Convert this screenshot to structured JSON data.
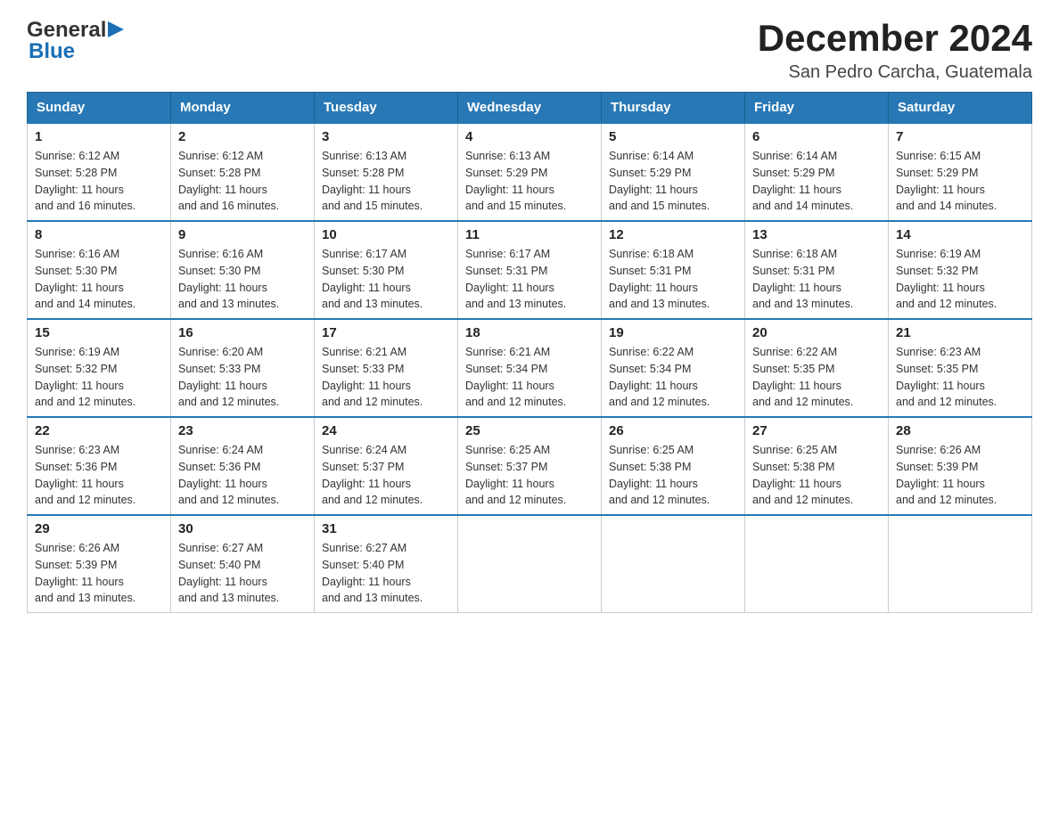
{
  "header": {
    "logo_general": "General",
    "logo_blue": "Blue",
    "title": "December 2024",
    "subtitle": "San Pedro Carcha, Guatemala"
  },
  "weekdays": [
    "Sunday",
    "Monday",
    "Tuesday",
    "Wednesday",
    "Thursday",
    "Friday",
    "Saturday"
  ],
  "weeks": [
    [
      {
        "day": "1",
        "sunrise": "6:12 AM",
        "sunset": "5:28 PM",
        "daylight": "11 hours and 16 minutes."
      },
      {
        "day": "2",
        "sunrise": "6:12 AM",
        "sunset": "5:28 PM",
        "daylight": "11 hours and 16 minutes."
      },
      {
        "day": "3",
        "sunrise": "6:13 AM",
        "sunset": "5:28 PM",
        "daylight": "11 hours and 15 minutes."
      },
      {
        "day": "4",
        "sunrise": "6:13 AM",
        "sunset": "5:29 PM",
        "daylight": "11 hours and 15 minutes."
      },
      {
        "day": "5",
        "sunrise": "6:14 AM",
        "sunset": "5:29 PM",
        "daylight": "11 hours and 15 minutes."
      },
      {
        "day": "6",
        "sunrise": "6:14 AM",
        "sunset": "5:29 PM",
        "daylight": "11 hours and 14 minutes."
      },
      {
        "day": "7",
        "sunrise": "6:15 AM",
        "sunset": "5:29 PM",
        "daylight": "11 hours and 14 minutes."
      }
    ],
    [
      {
        "day": "8",
        "sunrise": "6:16 AM",
        "sunset": "5:30 PM",
        "daylight": "11 hours and 14 minutes."
      },
      {
        "day": "9",
        "sunrise": "6:16 AM",
        "sunset": "5:30 PM",
        "daylight": "11 hours and 13 minutes."
      },
      {
        "day": "10",
        "sunrise": "6:17 AM",
        "sunset": "5:30 PM",
        "daylight": "11 hours and 13 minutes."
      },
      {
        "day": "11",
        "sunrise": "6:17 AM",
        "sunset": "5:31 PM",
        "daylight": "11 hours and 13 minutes."
      },
      {
        "day": "12",
        "sunrise": "6:18 AM",
        "sunset": "5:31 PM",
        "daylight": "11 hours and 13 minutes."
      },
      {
        "day": "13",
        "sunrise": "6:18 AM",
        "sunset": "5:31 PM",
        "daylight": "11 hours and 13 minutes."
      },
      {
        "day": "14",
        "sunrise": "6:19 AM",
        "sunset": "5:32 PM",
        "daylight": "11 hours and 12 minutes."
      }
    ],
    [
      {
        "day": "15",
        "sunrise": "6:19 AM",
        "sunset": "5:32 PM",
        "daylight": "11 hours and 12 minutes."
      },
      {
        "day": "16",
        "sunrise": "6:20 AM",
        "sunset": "5:33 PM",
        "daylight": "11 hours and 12 minutes."
      },
      {
        "day": "17",
        "sunrise": "6:21 AM",
        "sunset": "5:33 PM",
        "daylight": "11 hours and 12 minutes."
      },
      {
        "day": "18",
        "sunrise": "6:21 AM",
        "sunset": "5:34 PM",
        "daylight": "11 hours and 12 minutes."
      },
      {
        "day": "19",
        "sunrise": "6:22 AM",
        "sunset": "5:34 PM",
        "daylight": "11 hours and 12 minutes."
      },
      {
        "day": "20",
        "sunrise": "6:22 AM",
        "sunset": "5:35 PM",
        "daylight": "11 hours and 12 minutes."
      },
      {
        "day": "21",
        "sunrise": "6:23 AM",
        "sunset": "5:35 PM",
        "daylight": "11 hours and 12 minutes."
      }
    ],
    [
      {
        "day": "22",
        "sunrise": "6:23 AM",
        "sunset": "5:36 PM",
        "daylight": "11 hours and 12 minutes."
      },
      {
        "day": "23",
        "sunrise": "6:24 AM",
        "sunset": "5:36 PM",
        "daylight": "11 hours and 12 minutes."
      },
      {
        "day": "24",
        "sunrise": "6:24 AM",
        "sunset": "5:37 PM",
        "daylight": "11 hours and 12 minutes."
      },
      {
        "day": "25",
        "sunrise": "6:25 AM",
        "sunset": "5:37 PM",
        "daylight": "11 hours and 12 minutes."
      },
      {
        "day": "26",
        "sunrise": "6:25 AM",
        "sunset": "5:38 PM",
        "daylight": "11 hours and 12 minutes."
      },
      {
        "day": "27",
        "sunrise": "6:25 AM",
        "sunset": "5:38 PM",
        "daylight": "11 hours and 12 minutes."
      },
      {
        "day": "28",
        "sunrise": "6:26 AM",
        "sunset": "5:39 PM",
        "daylight": "11 hours and 12 minutes."
      }
    ],
    [
      {
        "day": "29",
        "sunrise": "6:26 AM",
        "sunset": "5:39 PM",
        "daylight": "11 hours and 13 minutes."
      },
      {
        "day": "30",
        "sunrise": "6:27 AM",
        "sunset": "5:40 PM",
        "daylight": "11 hours and 13 minutes."
      },
      {
        "day": "31",
        "sunrise": "6:27 AM",
        "sunset": "5:40 PM",
        "daylight": "11 hours and 13 minutes."
      },
      null,
      null,
      null,
      null
    ]
  ],
  "labels": {
    "sunrise": "Sunrise:",
    "sunset": "Sunset:",
    "daylight": "Daylight:"
  }
}
